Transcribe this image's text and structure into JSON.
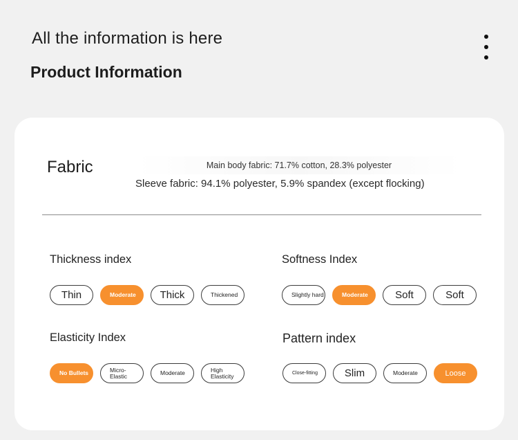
{
  "header": {
    "title": "All the information is here"
  },
  "section": {
    "title": "Product Information"
  },
  "fabric": {
    "label": "Fabric",
    "main": "Main body fabric: 71.7% cotton, 28.3% polyester",
    "sleeve": "Sleeve fabric: 94.1% polyester, 5.9% spandex (except flocking)"
  },
  "accent_color": "#f7902e",
  "indices": {
    "thickness": {
      "title": "Thickness index",
      "options": [
        "Thin",
        "Moderate",
        "Thick",
        "Thickened"
      ],
      "selected": "Moderate"
    },
    "softness": {
      "title": "Softness Index",
      "options": [
        "Slightly hard",
        "Moderate",
        "Soft",
        "Soft"
      ],
      "selected": "Moderate"
    },
    "elasticity": {
      "title": "Elasticity Index",
      "options": [
        "No Bullets",
        "Micro-Elastic",
        "Moderate",
        "High Elasticity"
      ],
      "selected": "No Bullets"
    },
    "pattern": {
      "title": "Pattern index",
      "options": [
        "Close-fitting",
        "Slim",
        "Moderate",
        "Loose"
      ],
      "selected": "Loose"
    }
  }
}
